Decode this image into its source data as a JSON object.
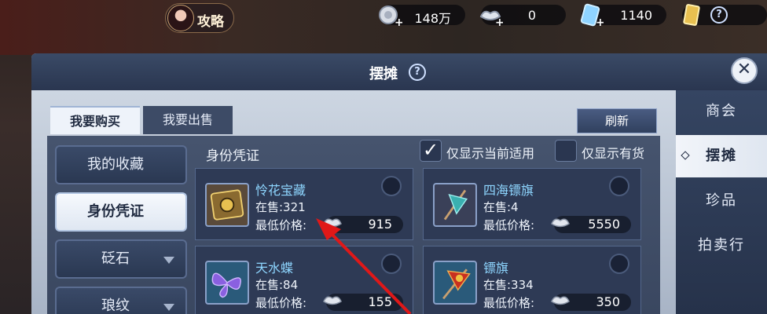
{
  "topbar": {
    "avatar_label": "攻略",
    "currencies": [
      {
        "icon": "silver-coin-add-icon",
        "value": "148万"
      },
      {
        "icon": "silver-ingot-add-icon",
        "value": "0"
      },
      {
        "icon": "diamond-ticket-add-icon",
        "value": "1140"
      },
      {
        "icon": "gold-token-icon",
        "value": ""
      }
    ],
    "help": "?"
  },
  "panel": {
    "title": "摆摊",
    "title_help": "?",
    "close": "✕",
    "tabs": [
      {
        "label": "我要购买",
        "active": true
      },
      {
        "label": "我要出售",
        "active": false
      }
    ],
    "refresh_label": "刷新",
    "section_title": "身份凭证",
    "filters": [
      {
        "label": "仅显示当前适用",
        "checked": true
      },
      {
        "label": "仅显示有货",
        "checked": false
      }
    ],
    "categories": [
      {
        "label": "我的收藏",
        "active": false,
        "dropdown": false
      },
      {
        "label": "身份凭证",
        "active": true,
        "dropdown": false
      },
      {
        "label": "砭石",
        "active": false,
        "dropdown": true
      },
      {
        "label": "琅纹",
        "active": false,
        "dropdown": true
      }
    ],
    "items": [
      {
        "name": "怜花宝藏",
        "stock": "在售:321",
        "price_label": "最低价格:",
        "price": "915",
        "icon": "treasure-box-icon"
      },
      {
        "name": "四海镖旗",
        "stock": "在售:4",
        "price_label": "最低价格:",
        "price": "5550",
        "icon": "escort-flag-icon"
      },
      {
        "name": "天水蝶",
        "stock": "在售:84",
        "price_label": "最低价格:",
        "price": "155",
        "icon": "butterfly-icon"
      },
      {
        "name": "镖旗",
        "stock": "在售:334",
        "price_label": "最低价格:",
        "price": "350",
        "icon": "red-flag-icon"
      }
    ]
  },
  "right_nav": [
    {
      "label": "商会",
      "active": false
    },
    {
      "label": "摆摊",
      "active": true
    },
    {
      "label": "珍品",
      "active": false
    },
    {
      "label": "拍卖行",
      "active": false
    }
  ],
  "colors": {
    "accent_arrow": "#e01818",
    "item_name": "#8ed6ff"
  }
}
